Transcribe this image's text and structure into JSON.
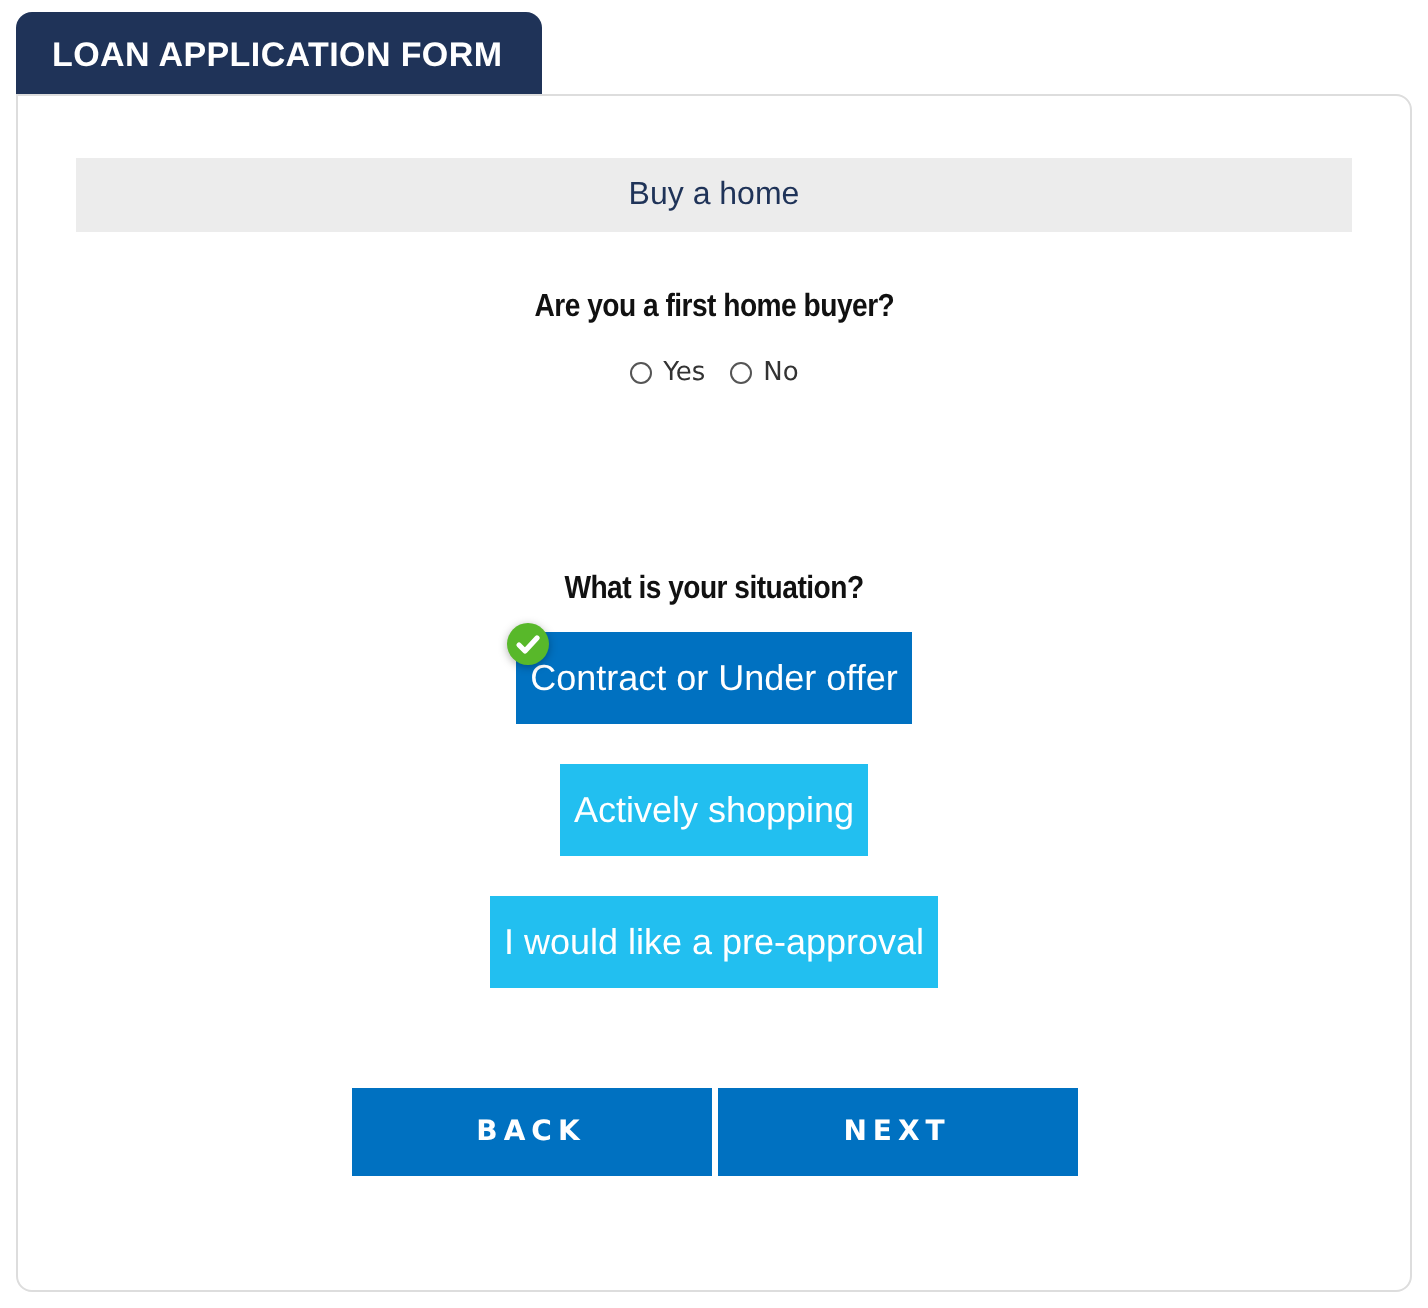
{
  "tab": {
    "title": "LOAN APPLICATION FORM"
  },
  "section": {
    "title": "Buy a home"
  },
  "questions": [
    {
      "kind": "radio",
      "label": "Are you a first home buyer?",
      "options": [
        {
          "label": "Yes",
          "selected": false
        },
        {
          "label": "No",
          "selected": false
        }
      ]
    },
    {
      "kind": "choice",
      "label": "What is your situation?",
      "options": [
        {
          "label": "Contract or Under offer",
          "selected": true
        },
        {
          "label": "Actively shopping",
          "selected": false
        },
        {
          "label": "I would like a pre-approval",
          "selected": false
        }
      ]
    }
  ],
  "buttons": [
    "BACK",
    "NEXT"
  ]
}
